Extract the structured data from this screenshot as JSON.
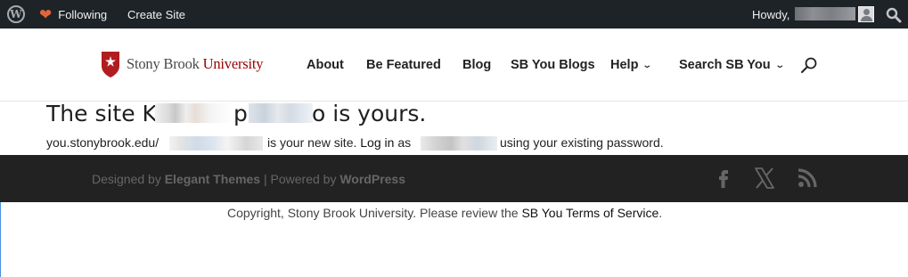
{
  "adminbar": {
    "following": "Following",
    "create_site": "Create Site",
    "howdy": "Howdy,"
  },
  "header": {
    "logo": {
      "part1": "Stony Brook",
      "part2": "University"
    },
    "nav": [
      {
        "label": "About",
        "dropdown": false
      },
      {
        "label": "Be Featured",
        "dropdown": false
      },
      {
        "label": "Blog",
        "dropdown": false
      },
      {
        "label": "SB You Blogs",
        "dropdown": false
      },
      {
        "label": "Help",
        "dropdown": true
      },
      {
        "label": "Search SB You",
        "dropdown": true
      }
    ]
  },
  "content": {
    "title_prefix": "The site K",
    "title_mid": "p",
    "title_suffix": "o is yours.",
    "url_prefix": "you.stonybrook.edu/",
    "new_site_text": "is your new site.",
    "login_link": "Log in",
    "as_text": "as",
    "password_text": "using your existing password."
  },
  "footer": {
    "designed_by": "Designed by",
    "elegant_themes": "Elegant Themes",
    "separator": "|",
    "powered_by": "Powered by",
    "wordpress": "WordPress",
    "social": [
      "facebook-icon",
      "x-icon",
      "rss-icon"
    ],
    "copyright_text": "Copyright, Stony Brook University. Please review the",
    "terms_link": "SB You Terms of Service",
    "period": "."
  },
  "colors": {
    "adminbar_bg": "#1d2327",
    "footer_bg": "#222222",
    "brand_red": "#990000",
    "heart": "#e2643a"
  }
}
